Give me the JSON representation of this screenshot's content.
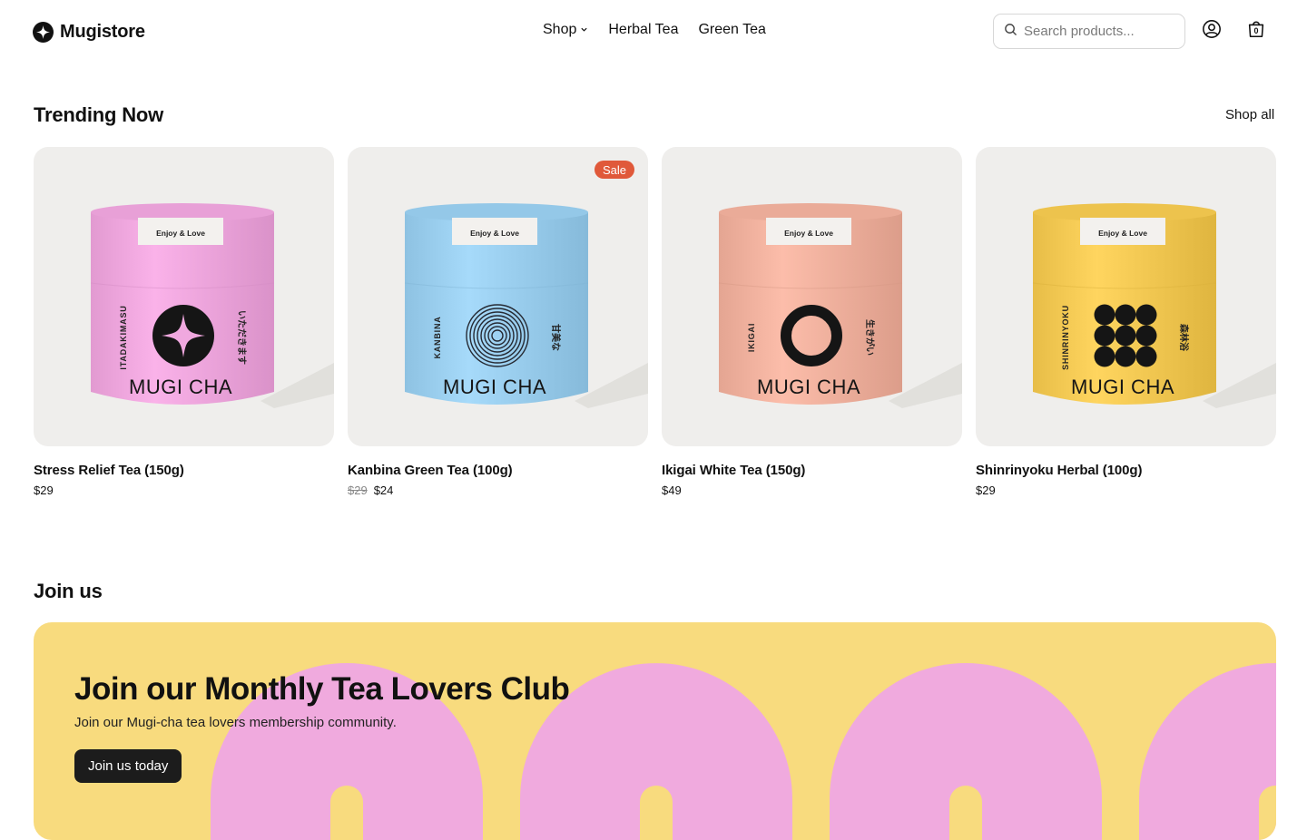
{
  "header": {
    "brand": "Mugistore",
    "nav": [
      {
        "label": "Shop",
        "has_dropdown": true
      },
      {
        "label": "Herbal Tea"
      },
      {
        "label": "Green Tea"
      }
    ],
    "search_placeholder": "Search products...",
    "cart_count": "0"
  },
  "trending": {
    "title": "Trending Now",
    "shop_all": "Shop all",
    "products": [
      {
        "name": "Stress Relief Tea (150g)",
        "price": "$29",
        "old_price": "",
        "badge": "",
        "tin_color": "#f0a8df",
        "side_left": "ITADAKIMASU",
        "side_right": "いただきます",
        "tin_label": "Enjoy & Love",
        "brand_text": "MUGI CHA",
        "emblem": "four-point-star"
      },
      {
        "name": "Kanbina Green Tea (100g)",
        "price": "$24",
        "old_price": "$29",
        "badge": "Sale",
        "tin_color": "#9cd0f0",
        "side_left": "KANBINA",
        "side_right": "甘美な",
        "tin_label": "Enjoy & Love",
        "brand_text": "MUGI CHA",
        "emblem": "concentric-rings"
      },
      {
        "name": "Ikigai White Tea (150g)",
        "price": "$49",
        "old_price": "",
        "badge": "",
        "tin_color": "#f2b3a0",
        "side_left": "IKIGAI",
        "side_right": "生きがい",
        "tin_label": "Enjoy & Love",
        "brand_text": "MUGI CHA",
        "emblem": "ring"
      },
      {
        "name": "Shinrinyoku Herbal (100g)",
        "price": "$29",
        "old_price": "",
        "badge": "",
        "tin_color": "#f5cb55",
        "side_left": "SHINRINYOKU",
        "side_right": "森林浴",
        "tin_label": "Enjoy & Love",
        "brand_text": "MUGI CHA",
        "emblem": "dot-grid"
      }
    ]
  },
  "join": {
    "title": "Join us",
    "banner_heading": "Join our Monthly Tea Lovers Club",
    "banner_subtitle": "Join our Mugi-cha tea lovers membership community.",
    "button": "Join us today",
    "banner_color": "#f8db7e",
    "shape_color": "#f0aade"
  }
}
